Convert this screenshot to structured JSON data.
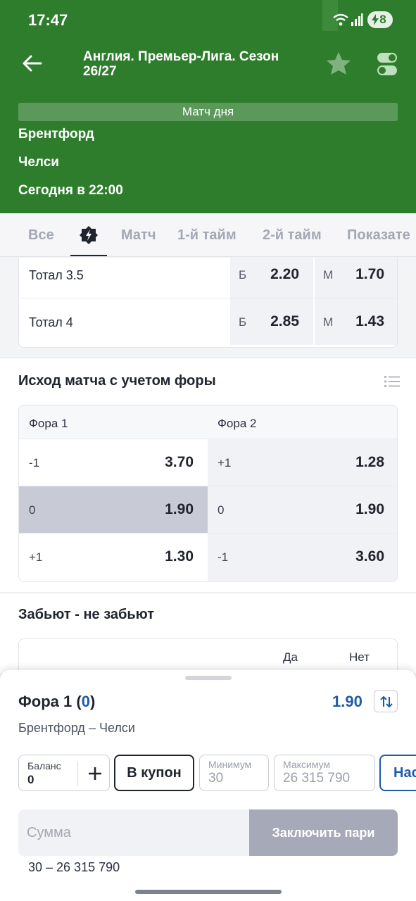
{
  "status_bar": {
    "time": "17:47",
    "battery": "8"
  },
  "header": {
    "title": "Англия. Премьер-Лига. Сезон 26/27",
    "match_day": "Матч дня",
    "team1": "Брентфорд",
    "team2": "Челси",
    "start_time": "Сегодня в 22:00",
    "accent_color": "#2e7d2c"
  },
  "tabs": [
    "Все",
    "Матч",
    "1-й тайм",
    "2-й тайм",
    "Показате"
  ],
  "totals": [
    {
      "label": "Тотал 3.5",
      "over_key": "Б",
      "over": "2.20",
      "under_key": "М",
      "under": "1.70"
    },
    {
      "label": "Тотал 4",
      "over_key": "Б",
      "over": "2.85",
      "under_key": "М",
      "under": "1.43"
    }
  ],
  "handicap": {
    "title": "Исход матча с учетом форы",
    "col1": "Фора 1",
    "col2": "Фора 2",
    "rows": [
      {
        "h1": "-1",
        "o1": "3.70",
        "h2": "+1",
        "o2": "1.28"
      },
      {
        "h1": "0",
        "o1": "1.90",
        "h2": "0",
        "o2": "1.90"
      },
      {
        "h1": "+1",
        "o1": "1.30",
        "h2": "-1",
        "o2": "3.60"
      }
    ]
  },
  "btts": {
    "title": "Забьют - не забьют",
    "yes": "Да",
    "no": "Нет"
  },
  "bet_slip": {
    "title_prefix": "Фора 1 (",
    "title_value": "0",
    "title_suffix": ")",
    "odd": "1.90",
    "match": "Брентфорд – Челси",
    "balance_label": "Баланс",
    "balance_value": "0",
    "coupon_label": "В купон",
    "min_label": "Минимум",
    "min_value": "30",
    "max_label": "Максимум",
    "max_value": "26 315 790",
    "settings_label": "Нас",
    "sum_placeholder": "Сумма",
    "place_label": "Заключить пари",
    "range": "30 – 26 315 790"
  }
}
